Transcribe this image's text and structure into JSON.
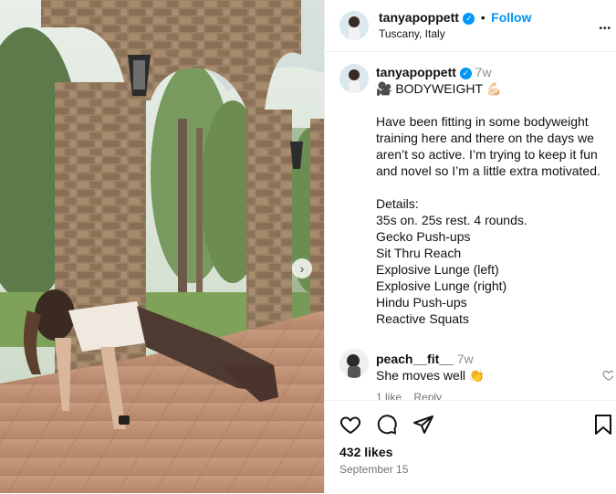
{
  "post": {
    "username": "tanyapoppett",
    "location": "Tuscany, Italy",
    "follow_label": "Follow",
    "separator": "•",
    "more_label": "•••"
  },
  "caption": {
    "username": "tanyapoppett",
    "time": "7w",
    "title": "🎥 BODYWEIGHT 💪🏻",
    "intro": "Have been fitting in some bodyweight training here and there on the days we aren’t so active. I’m trying to keep it fun and novel so I’m a little extra motivated.",
    "details_heading": "Details:",
    "details": [
      "35s on. 25s rest. 4 rounds.",
      "Gecko Push-ups",
      "Sit Thru Reach",
      "Explosive Lunge (left)",
      "Explosive Lunge (right)",
      "Hindu Push-ups",
      "Reactive Squats"
    ]
  },
  "comment": {
    "username": "peach__fit__",
    "time": "7w",
    "text": "She moves well 👏",
    "likes_label": "1 like",
    "reply_label": "Reply"
  },
  "footer": {
    "likes": "432 likes",
    "date": "September 15"
  },
  "icons": {
    "like": "heart-icon",
    "comment": "comment-icon",
    "share": "share-icon",
    "save": "bookmark-icon",
    "next": "chevron-right-icon"
  },
  "colors": {
    "accent": "#0095f6",
    "text": "#111111",
    "muted": "#8e8e8e"
  }
}
